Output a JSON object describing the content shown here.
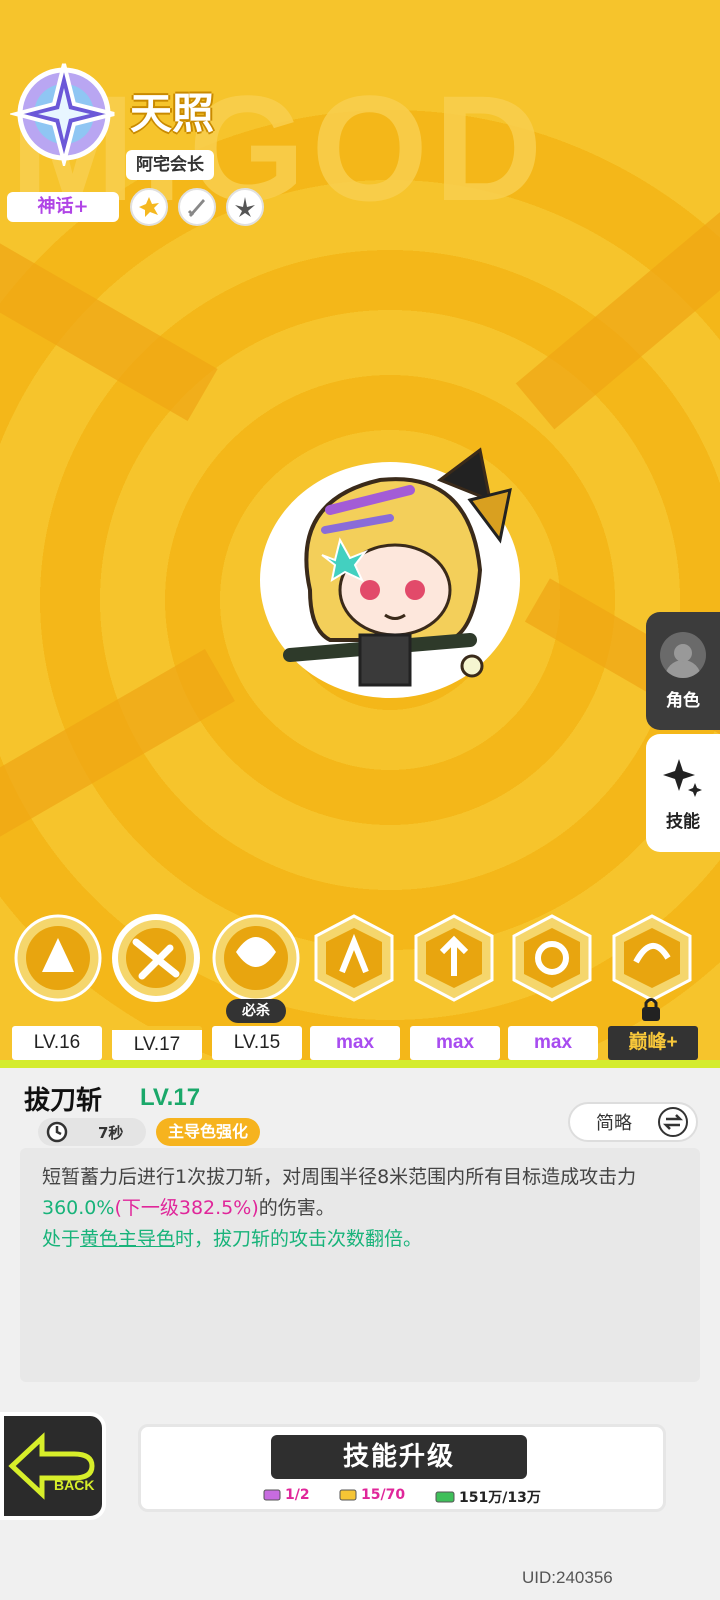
{
  "hero": {
    "name": "天照",
    "title": "阿宅会长",
    "rarity": "神话+",
    "bg_watermark": "M.GOD"
  },
  "side_tabs": [
    {
      "label": "角色"
    },
    {
      "label": "技能"
    }
  ],
  "skills": [
    {
      "level": "LV.16"
    },
    {
      "level": "LV.17",
      "selected": true
    },
    {
      "level": "LV.15",
      "tag": "必杀"
    },
    {
      "level": "max"
    },
    {
      "level": "max"
    },
    {
      "level": "max"
    },
    {
      "level": "巅峰+"
    }
  ],
  "detail": {
    "name": "拔刀斩",
    "level": "LV.17",
    "cooldown": "7秒",
    "tag": "主导色强化",
    "mode_button": "简略",
    "desc_prefix": "短暂蓄力后进行1次拔刀斩，对周围半径8米范围内所有目标造成攻击力",
    "desc_value": "360.0%",
    "desc_next": "(下一级382.5%)",
    "desc_suffix": "的伤害。",
    "bonus_prefix": "处于",
    "bonus_link": "黄色主导色",
    "bonus_suffix": "时，拔刀斩的攻击次数翻倍。"
  },
  "back_label": "BACK",
  "upgrade": {
    "label": "技能升级",
    "cost1": "1/2",
    "cost2": "15/70",
    "cost3": "151万/13万"
  },
  "uid": "UID:240356",
  "colors": {
    "accent_yellow": "#f6c42c",
    "green": "#18b37a",
    "pink": "#e0269a",
    "purple": "#a84cf0"
  }
}
